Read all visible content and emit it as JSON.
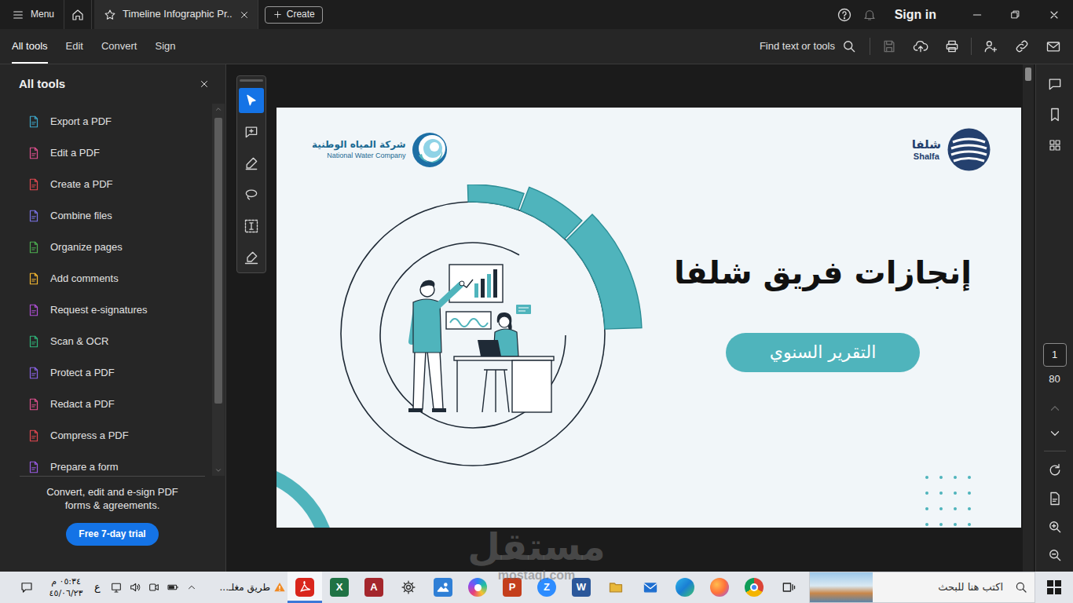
{
  "window": {
    "menu_label": "Menu",
    "tab": {
      "title": "Timeline Infographic Pr..",
      "selected": true
    },
    "create_label": "Create",
    "sign_in": "Sign in"
  },
  "toolbar": {
    "tabs": [
      {
        "label": "All tools",
        "selected": true
      },
      {
        "label": "Edit",
        "selected": false
      },
      {
        "label": "Convert",
        "selected": false
      },
      {
        "label": "Sign",
        "selected": false
      }
    ],
    "search_label": "Find text or tools",
    "actions": [
      {
        "kind": "save",
        "disabled": true
      },
      {
        "kind": "upload",
        "disabled": false
      },
      {
        "kind": "print",
        "disabled": false
      },
      {
        "kind": "share",
        "disabled": false
      },
      {
        "kind": "link",
        "disabled": false
      },
      {
        "kind": "mail",
        "disabled": false
      }
    ]
  },
  "sidebar": {
    "title": "All tools",
    "items": [
      {
        "label": "Export a PDF",
        "color": "#3da6c9"
      },
      {
        "label": "Edit a PDF",
        "color": "#e0508f"
      },
      {
        "label": "Create a PDF",
        "color": "#e34850"
      },
      {
        "label": "Combine files",
        "color": "#7b74e8"
      },
      {
        "label": "Organize pages",
        "color": "#4caf50"
      },
      {
        "label": "Add comments",
        "color": "#f5b731"
      },
      {
        "label": "Request e-signatures",
        "color": "#b04fd6"
      },
      {
        "label": "Scan & OCR",
        "color": "#2fb57a"
      },
      {
        "label": "Protect a PDF",
        "color": "#8a63e6"
      },
      {
        "label": "Redact a PDF",
        "color": "#e0508f"
      },
      {
        "label": "Compress a PDF",
        "color": "#e34850"
      },
      {
        "label": "Prepare a form",
        "color": "#9a5ce6"
      }
    ],
    "promo": "Convert, edit and e-sign PDF forms & agreements.",
    "trial_button": "Free 7-day trial"
  },
  "annotation_tools": [
    {
      "kind": "select",
      "selected": true
    },
    {
      "kind": "comment",
      "selected": false
    },
    {
      "kind": "highlight",
      "selected": false
    },
    {
      "kind": "draw",
      "selected": false
    },
    {
      "kind": "text",
      "selected": false
    },
    {
      "kind": "sign",
      "selected": false
    }
  ],
  "document": {
    "company_ar": "شركة المياه الوطنية",
    "company_en": "National Water Company",
    "brand_ar": "شلفا",
    "brand_en": "Shalfa",
    "title": "إنجازات فريق شلفا",
    "subtitle": "التقرير السنوي"
  },
  "page_nav": {
    "current": "1",
    "total": "80",
    "prev_disabled": true,
    "next_disabled": false
  },
  "taskbar": {
    "clock": {
      "time": "٠٥:٣٤ م",
      "date": "٤٥/٠٦/٢٣"
    },
    "language": "ع",
    "news": "طريق مغلـ...",
    "apps": [
      {
        "kind": "acrobat",
        "selected": true
      },
      {
        "kind": "excel",
        "glyph": "X",
        "selected": false
      },
      {
        "kind": "access",
        "glyph": "A",
        "selected": false
      },
      {
        "kind": "settings",
        "selected": false
      },
      {
        "kind": "photos",
        "selected": false
      },
      {
        "kind": "copilot",
        "selected": false
      },
      {
        "kind": "powerpoint",
        "glyph": "P",
        "selected": false
      },
      {
        "kind": "zoom",
        "glyph": "Z",
        "selected": false
      },
      {
        "kind": "word",
        "glyph": "W",
        "selected": false
      },
      {
        "kind": "explorer",
        "selected": false
      },
      {
        "kind": "mail",
        "selected": false
      },
      {
        "kind": "edge",
        "selected": false
      },
      {
        "kind": "firefox",
        "selected": false
      },
      {
        "kind": "chrome",
        "selected": false
      },
      {
        "kind": "taskview",
        "selected": false
      }
    ],
    "search_placeholder": "اكتب هنا للبحث"
  },
  "watermark": {
    "text_ar": "مستقل",
    "text_en": "mostaql.com"
  }
}
